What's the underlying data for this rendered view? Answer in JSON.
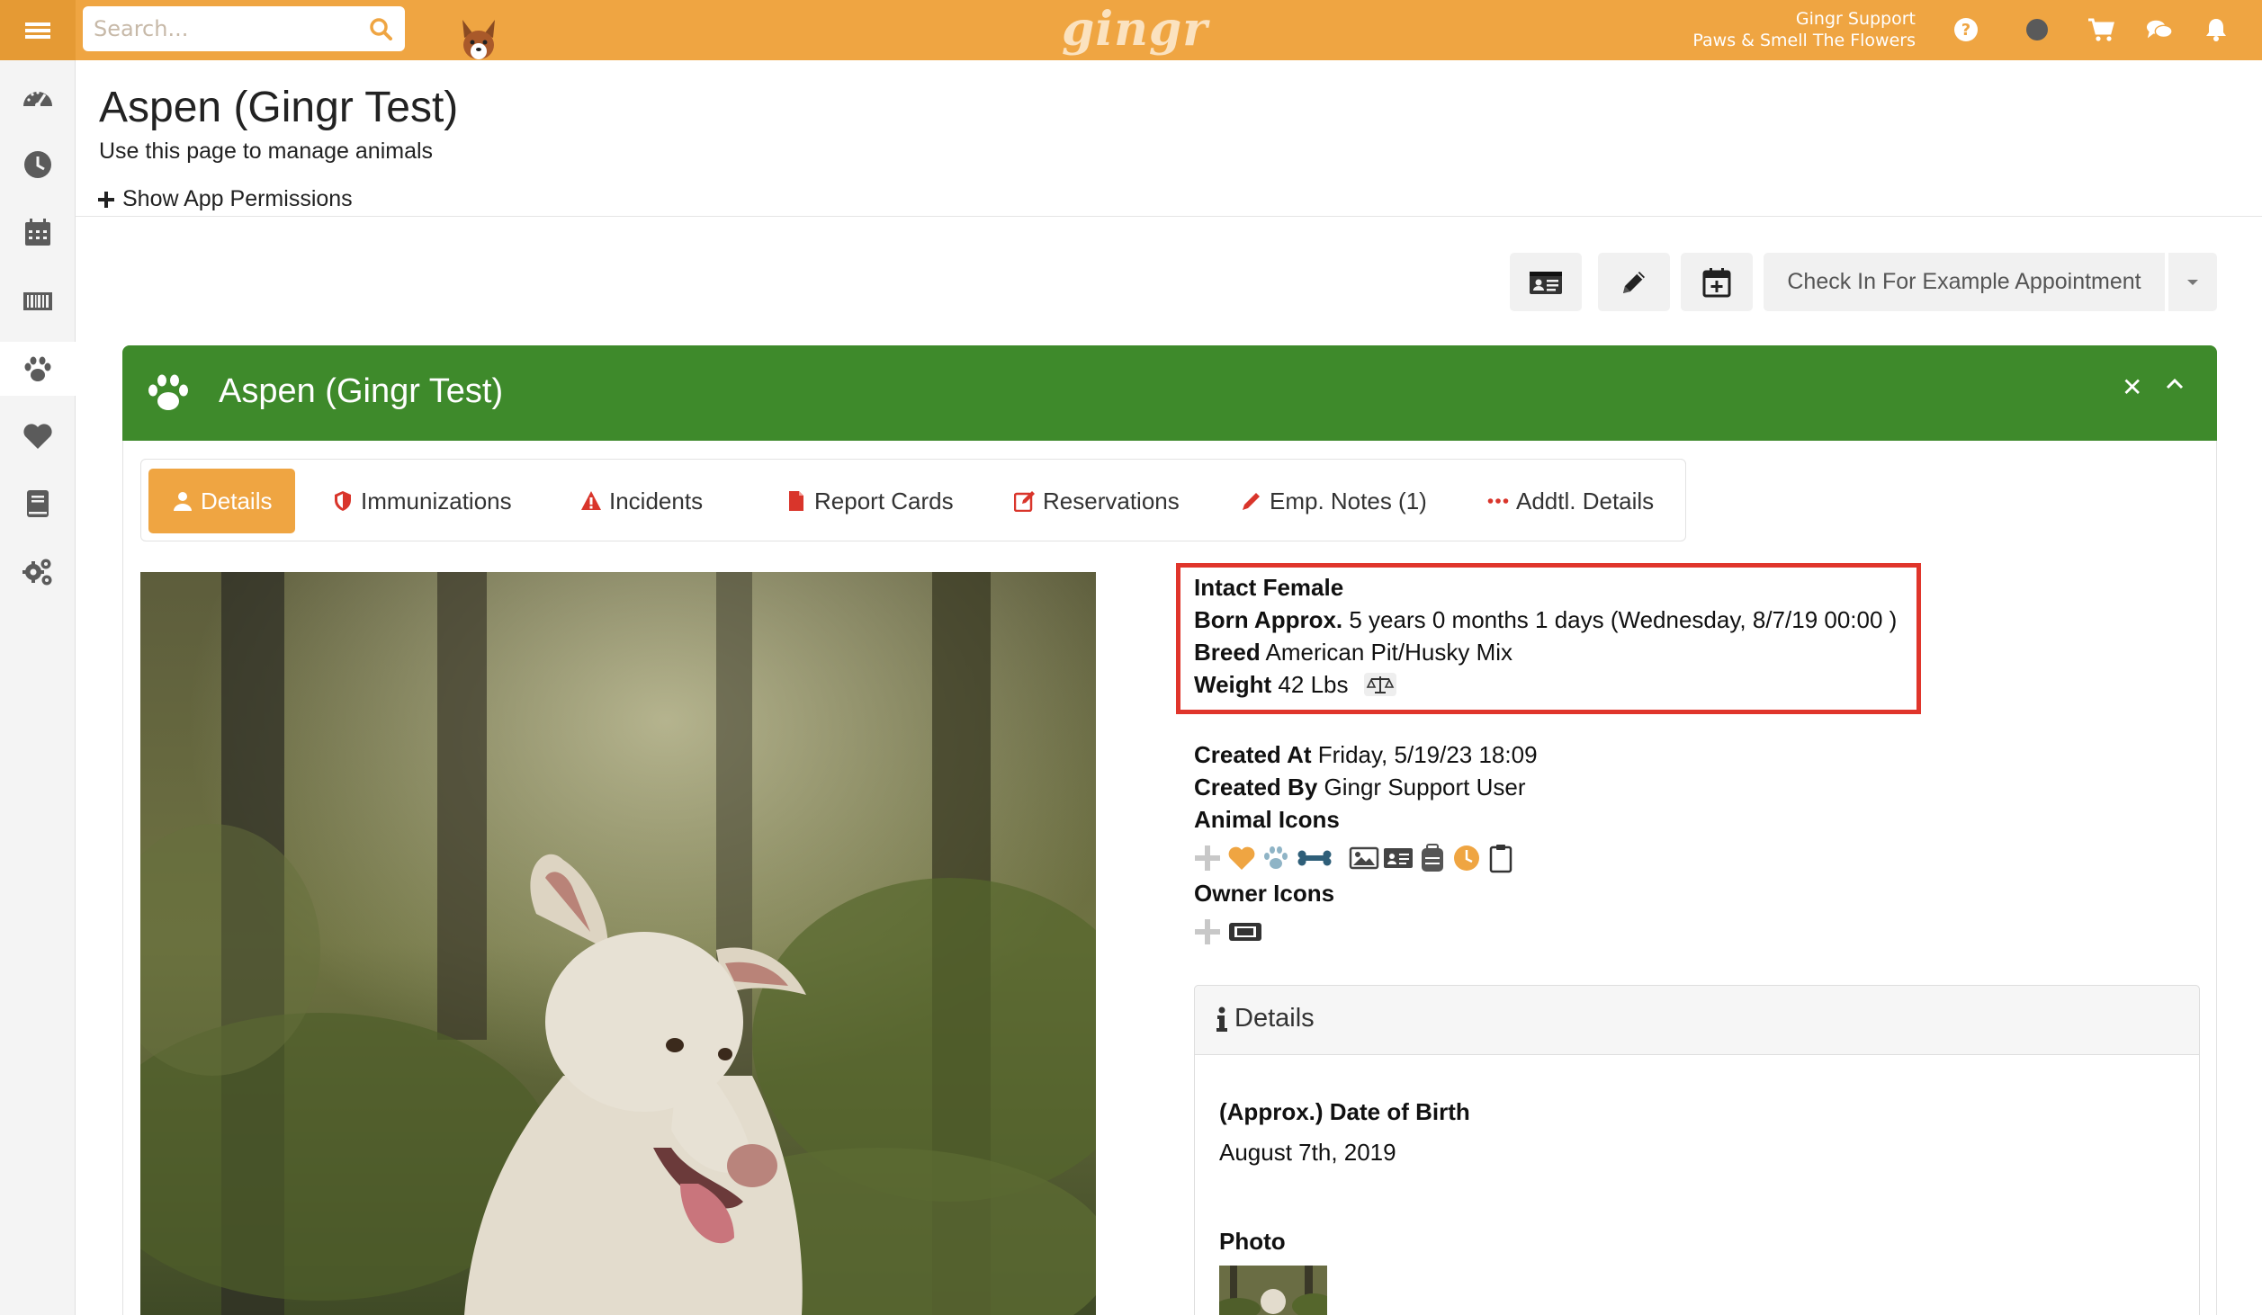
{
  "topbar": {
    "search_placeholder": "Search...",
    "logo_text": "gingr",
    "user_name": "Gingr Support",
    "location": "Paws & Smell The Flowers",
    "colors": {
      "bar": "#efa542",
      "accent": "#e59a34"
    }
  },
  "sidebar": {
    "items": [
      {
        "name": "dashboard",
        "icon": "speedometer-icon"
      },
      {
        "name": "history",
        "icon": "clock-icon"
      },
      {
        "name": "calendar",
        "icon": "calendar-icon"
      },
      {
        "name": "barcode",
        "icon": "barcode-icon"
      },
      {
        "name": "animals",
        "icon": "paw-icon",
        "active": true
      },
      {
        "name": "favorites",
        "icon": "heart-icon"
      },
      {
        "name": "reports",
        "icon": "book-icon"
      },
      {
        "name": "settings",
        "icon": "gears-icon"
      }
    ]
  },
  "page": {
    "title": "Aspen (Gingr Test)",
    "subtitle": "Use this page to manage animals",
    "permissions_link": "Show App Permissions"
  },
  "actions": {
    "checkin_label": "Check In For Example Appointment"
  },
  "panel": {
    "title": "Aspen (Gingr Test)",
    "color": "#3e8a2b"
  },
  "tabs": [
    {
      "label": "Details",
      "icon": "user-icon",
      "active": true
    },
    {
      "label": "Immunizations",
      "icon": "shield-icon"
    },
    {
      "label": "Incidents",
      "icon": "warning-icon"
    },
    {
      "label": "Report Cards",
      "icon": "file-icon"
    },
    {
      "label": "Reservations",
      "icon": "edit-icon"
    },
    {
      "label": "Emp. Notes (1)",
      "icon": "pencil-icon"
    },
    {
      "label": "Addtl. Details",
      "icon": "ellipsis-icon"
    }
  ],
  "animal": {
    "sex": "Intact Female",
    "born_label": "Born Approx.",
    "born_value": "5 years 0 months 1 days (Wednesday, 8/7/19 00:00 )",
    "breed_label": "Breed",
    "breed_value": "American Pit/Husky Mix",
    "weight_label": "Weight",
    "weight_value": "42 Lbs",
    "created_at_label": "Created At",
    "created_at_value": "Friday, 5/19/23 18:09",
    "created_by_label": "Created By",
    "created_by_value": "Gingr Support User",
    "animal_icons_label": "Animal Icons",
    "owner_icons_label": "Owner Icons"
  },
  "details_card": {
    "title": "Details",
    "dob_label": "(Approx.) Date of Birth",
    "dob_value": "August 7th, 2019",
    "photo_label": "Photo"
  }
}
